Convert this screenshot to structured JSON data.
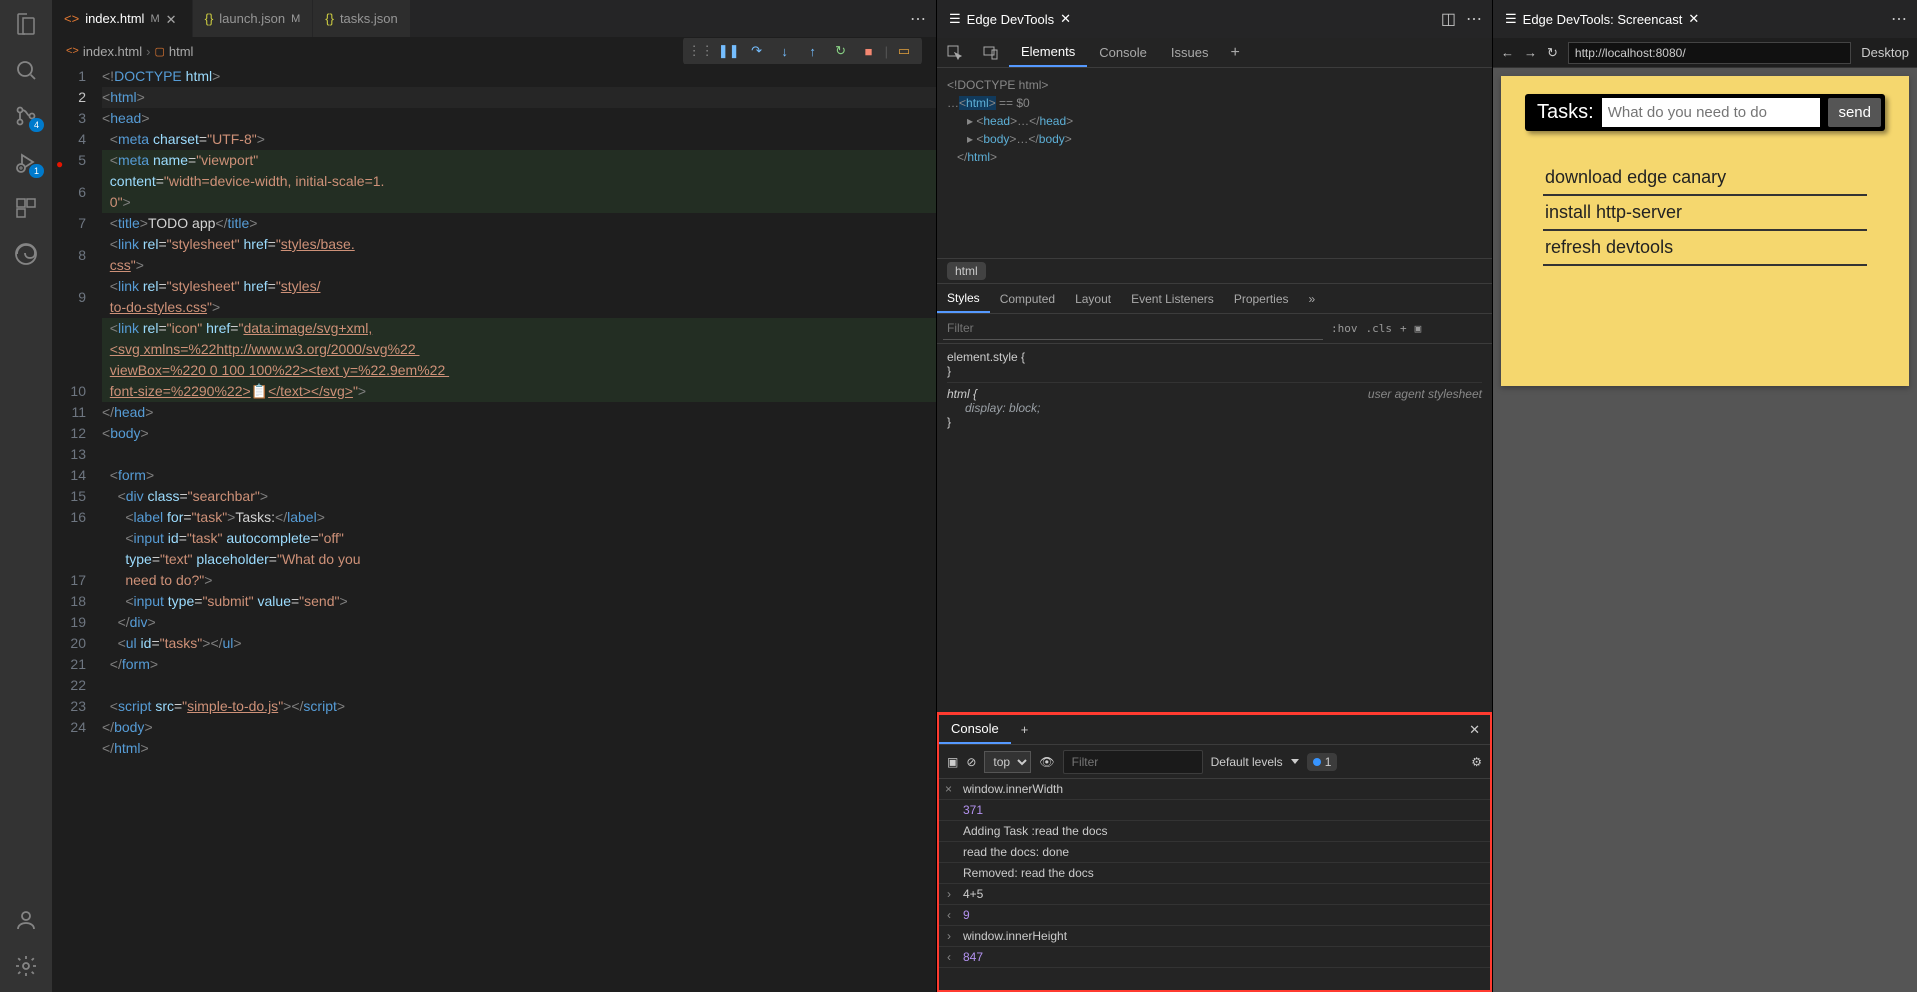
{
  "activity": {
    "scm_badge": "4",
    "debug_badge": "1"
  },
  "editorTabs": {
    "t0": {
      "label": "index.html",
      "mod": "M"
    },
    "t1": {
      "label": "launch.json",
      "mod": "M"
    },
    "t2": {
      "label": "tasks.json"
    }
  },
  "breadcrumb": {
    "file": "index.html",
    "node": "html"
  },
  "lines": {
    "l1": "1",
    "l2": "2",
    "l3": "3",
    "l4": "4",
    "l5": "5",
    "l6": "6",
    "l7": "7",
    "l8": "8",
    "l9": "9",
    "l10": "10",
    "l11": "11",
    "l12": "12",
    "l13": "13",
    "l14": "14",
    "l15": "15",
    "l16": "16",
    "l17": "17",
    "l18": "18",
    "l19": "19",
    "l20": "20",
    "l21": "21",
    "l22": "22",
    "l23": "23",
    "l24": "24"
  },
  "devtoolsTab": "Edge DevTools",
  "dtPanels": {
    "elements": "Elements",
    "console": "Console",
    "issues": "Issues"
  },
  "dom": {
    "l1": "<!DOCTYPE html>",
    "l2a": "…",
    "l2b": "<html>",
    "l2c": " == $0",
    "l3": "<head>…</head>",
    "l4": "<body>…</body>",
    "l5": "</html>"
  },
  "crumb": "html",
  "stylesTabs": {
    "styles": "Styles",
    "computed": "Computed",
    "layout": "Layout",
    "events": "Event Listeners",
    "props": "Properties"
  },
  "stylesFilter": {
    "placeholder": "Filter",
    "hov": ":hov",
    "cls": ".cls"
  },
  "styleRules": {
    "r1sel": "element.style {",
    "r1end": "}",
    "r2sel": "html {",
    "r2prop": "display: block;",
    "r2end": "}",
    "r2src": "user agent stylesheet"
  },
  "consoleTab": "Console",
  "consoleFilter": {
    "context": "top",
    "placeholder": "Filter",
    "levels": "Default levels",
    "issueCount": "1"
  },
  "consoleRows": {
    "r1in": "window.innerWidth",
    "r1out": "371",
    "r2a": "Adding Task :read the docs",
    "r2b": "read the docs: done",
    "r2c": "Removed: read the docs",
    "r3in": "4+5",
    "r3out": "9",
    "r4in": "window.innerHeight",
    "r4out": "847"
  },
  "screencast": {
    "tab": "Edge DevTools: Screencast",
    "url": "http://localhost:8080/",
    "mode": "Desktop"
  },
  "app": {
    "label": "Tasks:",
    "placeholder": "What do you need to do",
    "submit": "send",
    "items": {
      "i0": "download edge canary",
      "i1": "install http-server",
      "i2": "refresh devtools"
    }
  }
}
